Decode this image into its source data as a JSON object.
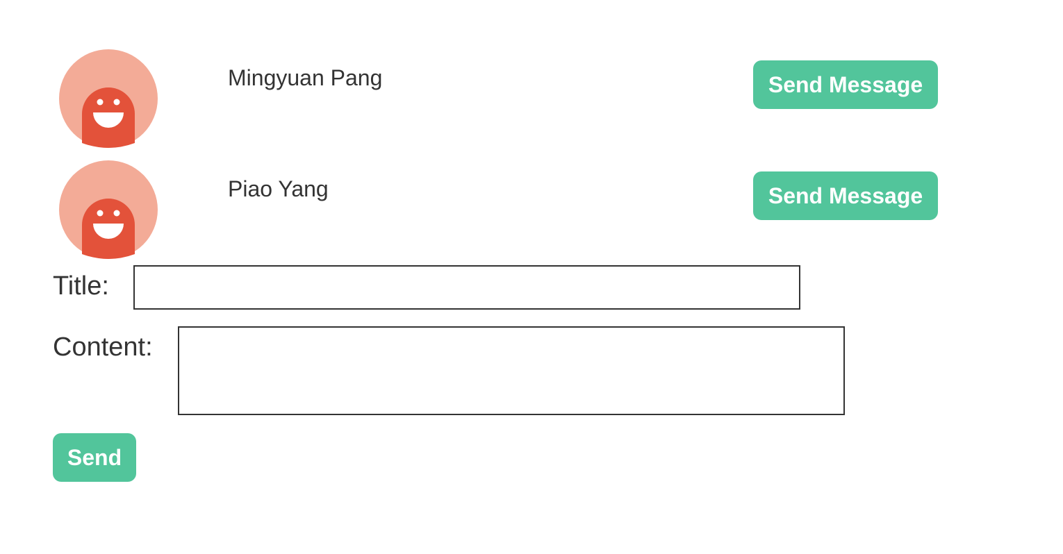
{
  "colors": {
    "accent": "#52c59b",
    "avatar_bg": "#f3ab97",
    "avatar_face": "#e3523a",
    "text": "#333333"
  },
  "contacts": [
    {
      "name": "Mingyuan Pang",
      "action_label": "Send Message",
      "avatar_icon": "smiley-avatar-icon"
    },
    {
      "name": "Piao Yang",
      "action_label": "Send Message",
      "avatar_icon": "smiley-avatar-icon"
    }
  ],
  "form": {
    "title_label": "Title:",
    "title_value": "",
    "content_label": "Content:",
    "content_value": "",
    "send_label": "Send"
  }
}
